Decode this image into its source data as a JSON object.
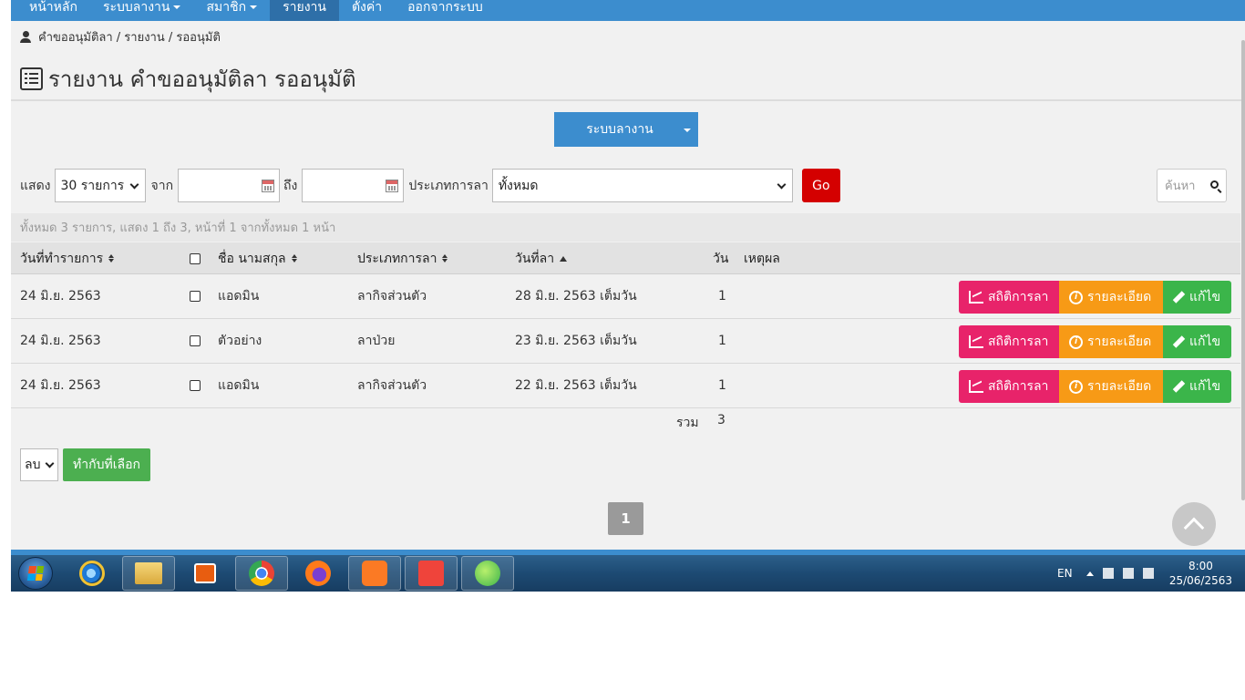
{
  "nav": {
    "items": [
      {
        "label": "หน้าหลัก"
      },
      {
        "label": "ระบบลางาน"
      },
      {
        "label": "สมาชิก"
      },
      {
        "label": "รายงาน"
      },
      {
        "label": "ตั้งค่า"
      },
      {
        "label": "ออกจากระบบ"
      }
    ]
  },
  "breadcrumb": {
    "text": "คำขออนุมัติลา / รายงาน / รออนุมัติ"
  },
  "page": {
    "title": "รายงาน คำขออนุมัติลา รออนุมัติ"
  },
  "module_dropdown": {
    "label": "ระบบลางาน"
  },
  "filters": {
    "show_label": "แสดง",
    "page_size": "30 รายการ",
    "from_label": "จาก",
    "to_label": "ถึง",
    "type_label": "ประเภทการลา",
    "type_value": "ทั้งหมด",
    "go_label": "Go",
    "search_placeholder": "ค้นหา"
  },
  "summary": "ทั้งหมด 3 รายการ, แสดง 1 ถึง 3, หน้าที่ 1 จากทั้งหมด 1 หน้า",
  "table": {
    "headers": {
      "created": "วันที่ทำรายการ",
      "name": "ชื่อ นามสกุล",
      "type": "ประเภทการลา",
      "leave_date": "วันที่ลา",
      "days": "วัน",
      "reason": "เหตุผล"
    },
    "rows": [
      {
        "created": "24 มิ.ย. 2563",
        "name": "แอดมิน",
        "type": "ลากิจส่วนตัว",
        "leave_date": "28 มิ.ย. 2563 เต็มวัน",
        "days": "1"
      },
      {
        "created": "24 มิ.ย. 2563",
        "name": "ตัวอย่าง",
        "type": "ลาป่วย",
        "leave_date": "23 มิ.ย. 2563 เต็มวัน",
        "days": "1"
      },
      {
        "created": "24 มิ.ย. 2563",
        "name": "แอดมิน",
        "type": "ลากิจส่วนตัว",
        "leave_date": "22 มิ.ย. 2563 เต็มวัน",
        "days": "1"
      }
    ],
    "actions": {
      "stat": "สถิติการลา",
      "detail": "รายละเอียด",
      "edit": "แก้ไข"
    },
    "total_label": "รวม",
    "total_value": "3"
  },
  "bulk": {
    "select_value": "ลบ",
    "button_label": "ทำกับที่เลือก"
  },
  "pagination": {
    "current": "1"
  },
  "taskbar": {
    "language": "EN",
    "time": "8:00",
    "date": "25/06/2563"
  },
  "colors": {
    "nav": "#3c8dce",
    "go": "#d40000",
    "stat": "#e8236a",
    "detail": "#f79a16",
    "edit": "#3bb54a"
  }
}
